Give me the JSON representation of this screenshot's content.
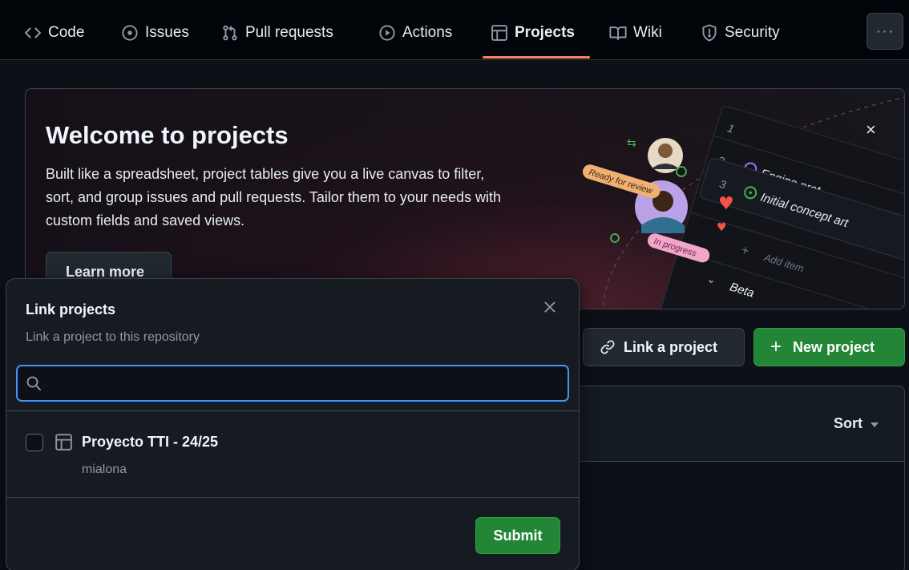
{
  "nav": {
    "tabs": [
      {
        "label": "Code",
        "icon": "code-icon"
      },
      {
        "label": "Issues",
        "icon": "issue-opened-icon"
      },
      {
        "label": "Pull requests",
        "icon": "git-pull-request-icon"
      },
      {
        "label": "Actions",
        "icon": "play-icon"
      },
      {
        "label": "Projects",
        "icon": "table-icon",
        "active": true
      },
      {
        "label": "Wiki",
        "icon": "book-icon"
      },
      {
        "label": "Security",
        "icon": "shield-icon"
      }
    ],
    "more_label": "···"
  },
  "banner": {
    "title": "Welcome to projects",
    "text": "Built like a spreadsheet, project tables give you a live canvas to filter, sort, and group issues and pull requests. Tailor them to your needs with custom fields and saved views.",
    "learn_more": "Learn more",
    "close": "×",
    "art": {
      "ready_tag": "Ready for review",
      "progress_tag": "In progress",
      "rows": [
        {
          "num": "1",
          "title": ""
        },
        {
          "num": "2",
          "title": "Engine prot"
        },
        {
          "num": "3",
          "title": "Initial concept art"
        }
      ],
      "add_item": "Add item",
      "group_label": "Beta"
    }
  },
  "actions": {
    "link_project": "Link a project",
    "new_project": "New project",
    "new_plus": "+"
  },
  "list": {
    "sort_label": "Sort"
  },
  "dialog": {
    "title": "Link projects",
    "subtitle": "Link a project to this repository",
    "search_value": "",
    "projects": [
      {
        "name": "Proyecto TTI - 24/25",
        "owner": "mialona",
        "checked": false
      }
    ],
    "submit": "Submit"
  },
  "colors": {
    "accent_blue": "#4493f8",
    "primary_green": "#238636",
    "tab_underline": "#f78166",
    "background": "#0d1117"
  }
}
